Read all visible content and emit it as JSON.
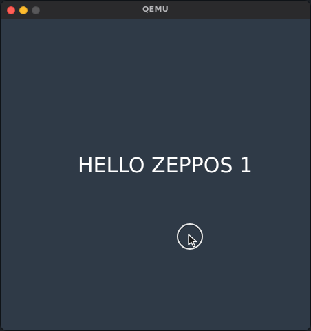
{
  "window": {
    "title": "QEMU",
    "buttons": {
      "close": "close-icon",
      "minimize": "minimize-icon",
      "maximize": "maximize-icon"
    },
    "colors": {
      "content_bg": "#2f3a47",
      "titlebar_bg": "#2a2a2c",
      "text": "#ffffff"
    }
  },
  "screen": {
    "message": "HELLO ZEPPOS 1"
  },
  "cursor": {
    "icon": "pointer-arrow-icon"
  }
}
